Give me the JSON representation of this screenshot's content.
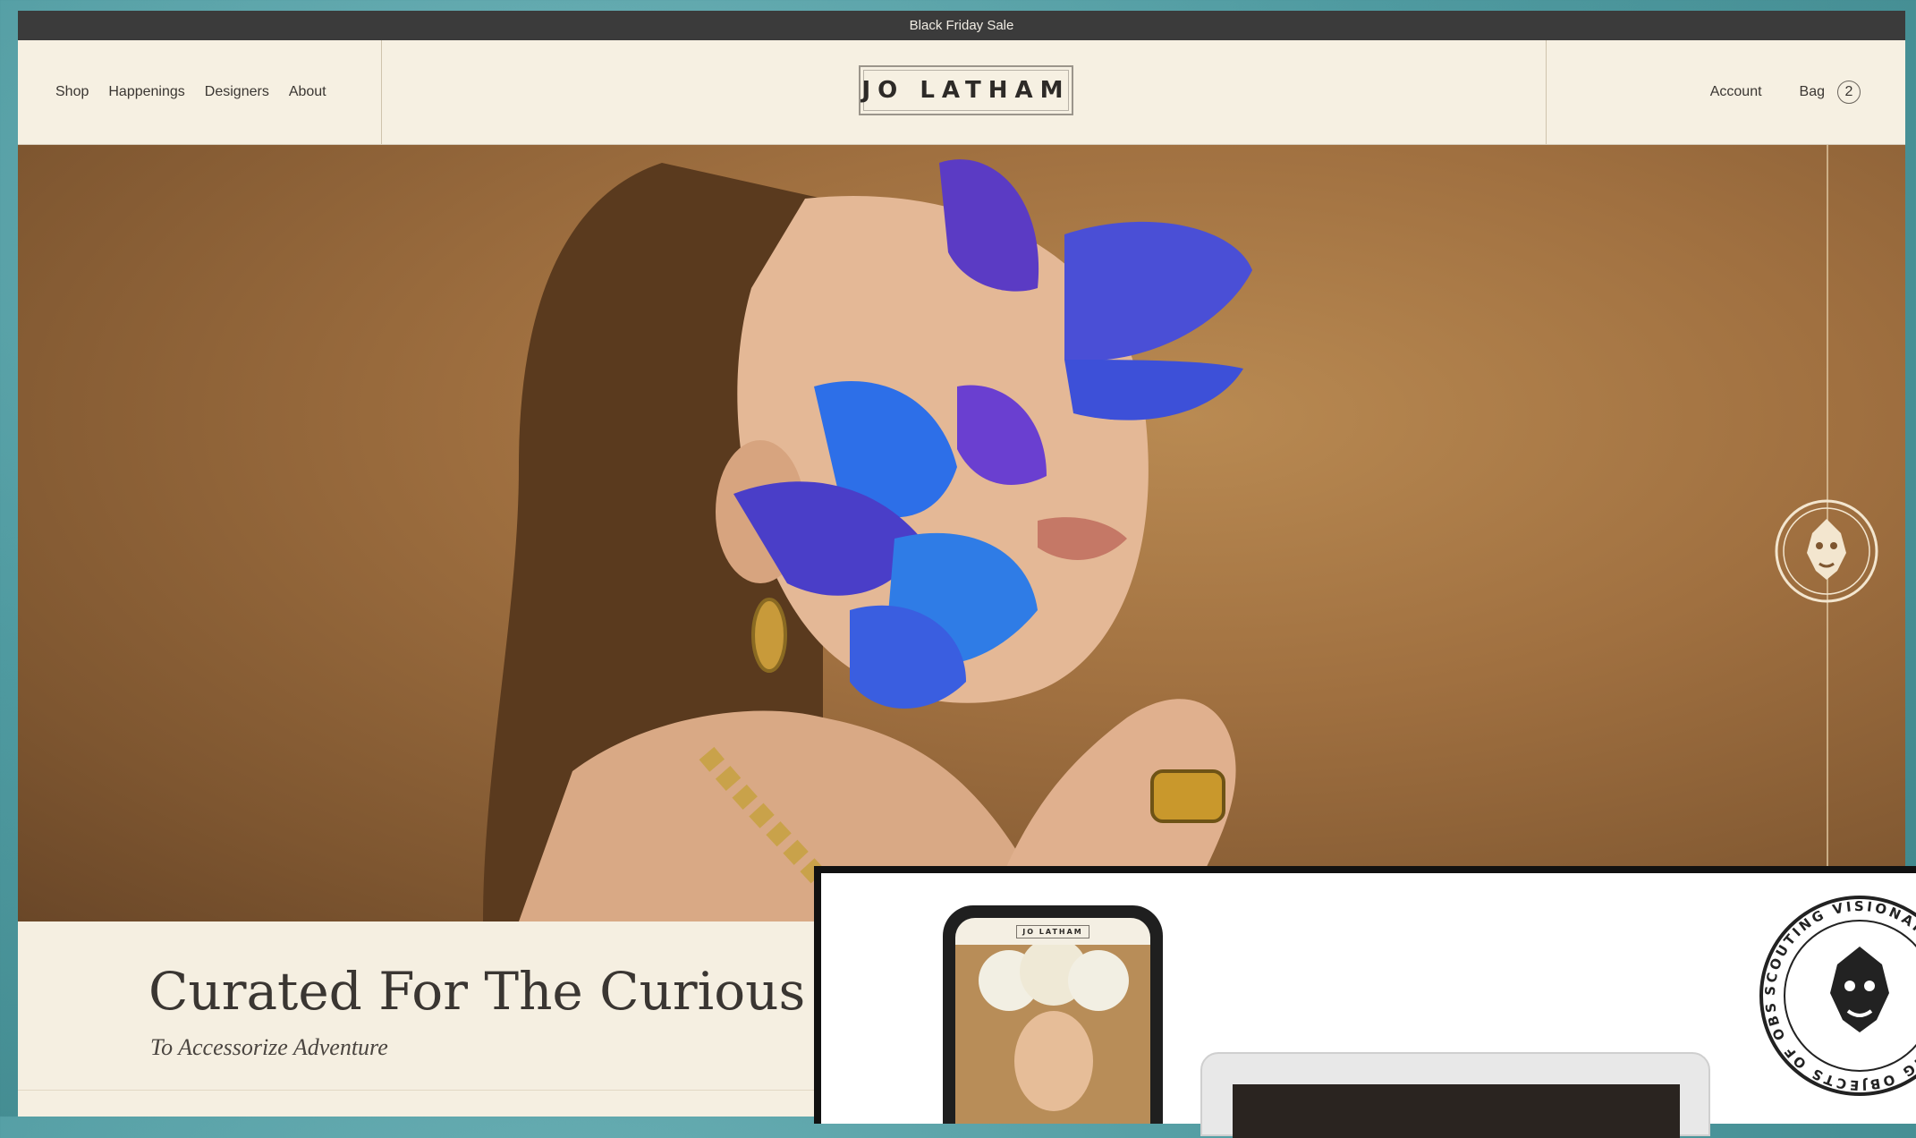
{
  "promo_banner": "Black Friday Sale",
  "nav": {
    "left": [
      "Shop",
      "Happenings",
      "Designers",
      "About"
    ],
    "logo": "JO LATHAM",
    "account": "Account",
    "bag": "Bag",
    "bag_count": "2"
  },
  "hero": {
    "heading": "Curated For The Curious",
    "subheading": "To Accessorize Adventure"
  },
  "overlay": {
    "phone_logo": "JO LATHAM",
    "seal_text": "SCOUTING VISIONARIES • CURATING OBJECTS OF OBSESSION"
  },
  "colors": {
    "background": "#4f9aa0",
    "header_bg": "#f6f0e2",
    "promo_bg": "#3b3b3b",
    "hero_bg": "#a07040",
    "butterfly_blue": "#3b6fe0",
    "butterfly_purple": "#6a3fd0"
  },
  "icons": [
    "lion-crest-icon",
    "bag-count-circle"
  ]
}
